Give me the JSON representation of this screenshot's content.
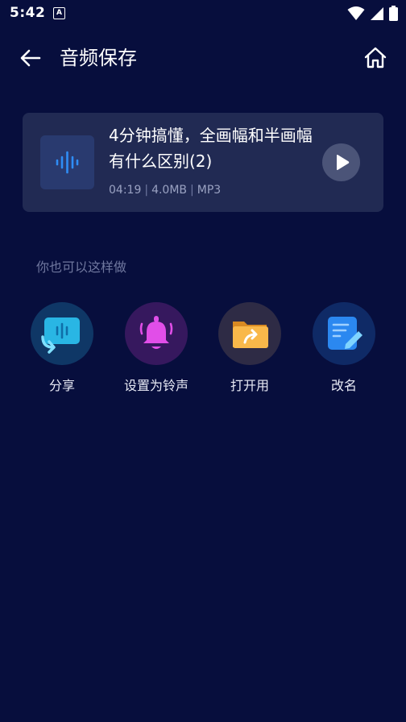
{
  "status_bar": {
    "time": "5:42",
    "notification_letter": "A",
    "icons": [
      "wifi-icon",
      "signal-icon",
      "battery-icon"
    ]
  },
  "header": {
    "title": "音频保存",
    "back_icon": "arrow-left-icon",
    "home_icon": "home-icon"
  },
  "file_card": {
    "title": "4分钟搞懂，全画幅和半画幅有什么区别(2)",
    "duration": "04:19",
    "size": "4.0MB",
    "format": "MP3",
    "separator": "|",
    "thumb_icon": "audio-wave-icon",
    "play_icon": "play-icon"
  },
  "hint": "你也可以这样做",
  "actions": [
    {
      "label": "分享",
      "icon": "share-icon",
      "color": "#2fb7e0"
    },
    {
      "label": "设置为铃声",
      "icon": "bell-icon",
      "color": "#e14ee8"
    },
    {
      "label": "打开用",
      "icon": "folder-open-icon",
      "color": "#f6a53b"
    },
    {
      "label": "改名",
      "icon": "rename-icon",
      "color": "#2b88f0"
    }
  ],
  "colors": {
    "background": "#070e3d",
    "card": "#212a53",
    "muted_text": "#6f779e"
  }
}
